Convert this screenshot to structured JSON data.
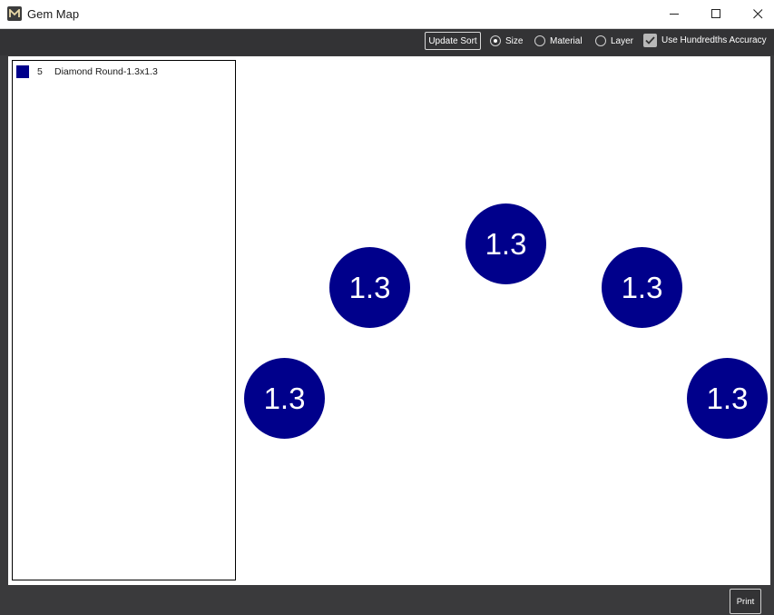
{
  "window": {
    "title": "Gem Map",
    "logo_letter": "M"
  },
  "toolbar": {
    "update_sort_label": "Update Sort",
    "sort_options": [
      {
        "label": "Size",
        "selected": true
      },
      {
        "label": "Material",
        "selected": false
      },
      {
        "label": "Layer",
        "selected": false
      }
    ],
    "hundredths": {
      "label": "Use Hundredths Accuracy",
      "checked": true
    }
  },
  "legend": {
    "items": [
      {
        "count": "5",
        "name": "Diamond Round-1.3x1.3",
        "color": "#00008b"
      }
    ]
  },
  "gems": [
    {
      "label": "1.3",
      "color": "#00008b"
    },
    {
      "label": "1.3",
      "color": "#00008b"
    },
    {
      "label": "1.3",
      "color": "#00008b"
    },
    {
      "label": "1.3",
      "color": "#00008b"
    },
    {
      "label": "1.3",
      "color": "#00008b"
    }
  ],
  "footer": {
    "print_label": "Print"
  }
}
